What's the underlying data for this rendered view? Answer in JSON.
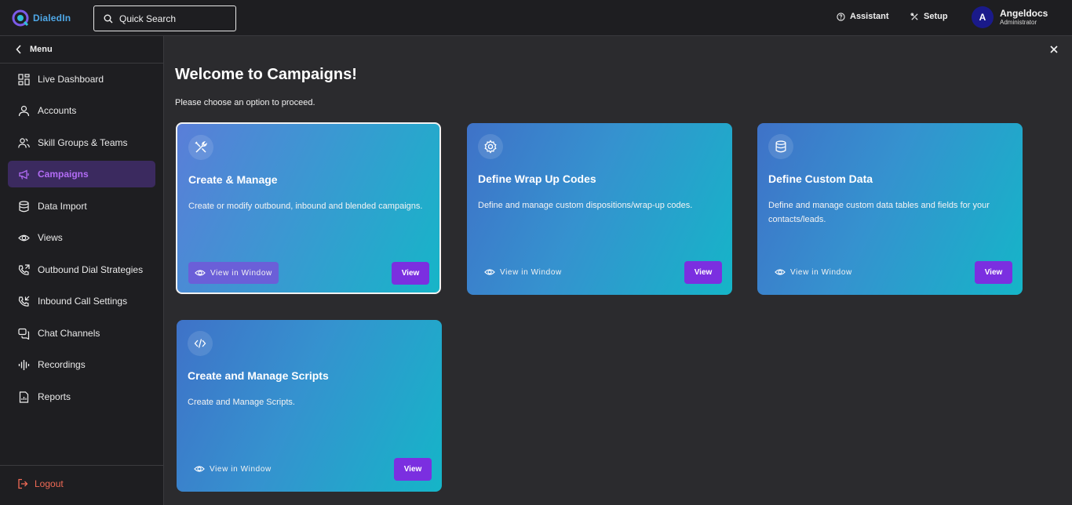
{
  "app": {
    "logo_text": "DialedIn"
  },
  "search": {
    "placeholder": "Quick Search"
  },
  "topbar": {
    "assistant_label": "Assistant",
    "setup_label": "Setup",
    "user": {
      "initial": "A",
      "name": "Angeldocs",
      "role": "Administrator"
    }
  },
  "sidebar": {
    "menu_label": "Menu",
    "items": [
      {
        "label": "Live Dashboard",
        "icon": "dashboard-icon"
      },
      {
        "label": "Accounts",
        "icon": "user-icon"
      },
      {
        "label": "Skill Groups & Teams",
        "icon": "users-icon"
      },
      {
        "label": "Campaigns",
        "icon": "megaphone-icon",
        "active": true
      },
      {
        "label": "Data Import",
        "icon": "database-icon"
      },
      {
        "label": "Views",
        "icon": "eye-icon"
      },
      {
        "label": "Outbound Dial Strategies",
        "icon": "phone-outgoing-icon"
      },
      {
        "label": "Inbound Call Settings",
        "icon": "phone-incoming-icon"
      },
      {
        "label": "Chat Channels",
        "icon": "chat-icon"
      },
      {
        "label": "Recordings",
        "icon": "waveform-icon"
      },
      {
        "label": "Reports",
        "icon": "report-icon"
      }
    ],
    "logout_label": "Logout"
  },
  "main": {
    "title": "Welcome to Campaigns!",
    "subtitle": "Please choose an option to proceed.",
    "cards": [
      {
        "title": "Create & Manage",
        "description": "Create or modify outbound, inbound and blended campaigns.",
        "icon": "tools-icon",
        "window_label": "View in Window",
        "view_label": "View"
      },
      {
        "title": "Define Wrap Up Codes",
        "description": "Define and manage custom dispositions/wrap-up codes.",
        "icon": "gear-icon",
        "window_label": "View in Window",
        "view_label": "View"
      },
      {
        "title": "Define Custom Data",
        "description": "Define and manage custom data tables and fields for your contacts/leads.",
        "icon": "database-icon",
        "window_label": "View in Window",
        "view_label": "View"
      },
      {
        "title": "Create and Manage Scripts",
        "description": "Create and Manage Scripts.",
        "icon": "code-icon",
        "window_label": "View in Window",
        "view_label": "View"
      }
    ]
  },
  "colors": {
    "accent": "#7b2fe0",
    "active_nav_text": "#b26cf5",
    "logout": "#f06a55"
  }
}
